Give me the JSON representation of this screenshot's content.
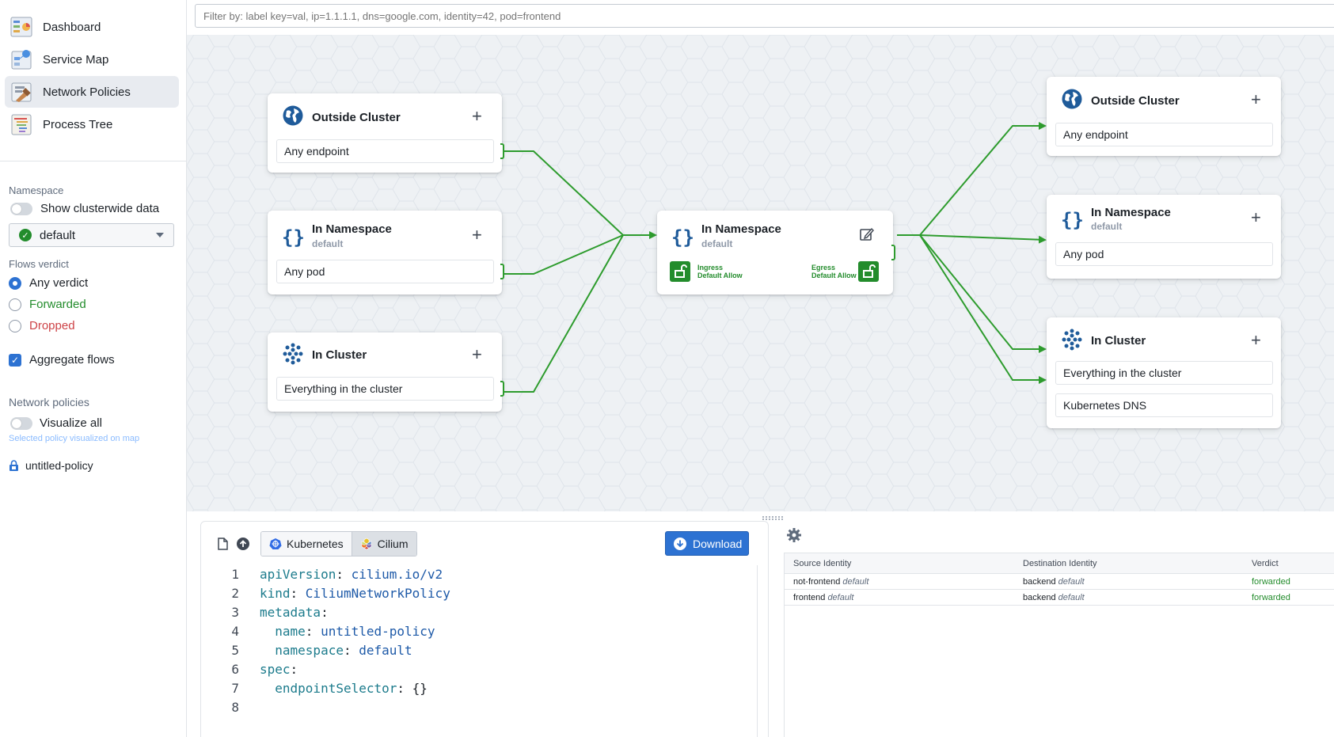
{
  "sidebar": {
    "nav": [
      {
        "label": "Dashboard",
        "icon": "dashboard-icon"
      },
      {
        "label": "Service Map",
        "icon": "service-map-icon"
      },
      {
        "label": "Network Policies",
        "icon": "network-policies-icon",
        "active": true
      },
      {
        "label": "Process Tree",
        "icon": "process-tree-icon"
      }
    ],
    "namespace_label": "Namespace",
    "show_clusterwide_label": "Show clusterwide data",
    "namespace_value": "default",
    "flows_verdict_label": "Flows verdict",
    "verdicts": [
      {
        "label": "Any verdict",
        "selected": true,
        "color": "#1c2127"
      },
      {
        "label": "Forwarded",
        "selected": false,
        "color": "#238c2c"
      },
      {
        "label": "Dropped",
        "selected": false,
        "color": "#cd4246"
      }
    ],
    "aggregate_flows_label": "Aggregate flows",
    "aggregate_flows_checked": true,
    "network_policies_label": "Network policies",
    "visualize_all_label": "Visualize all",
    "visualize_hint": "Selected policy visualized on map",
    "policy_name": "untitled-policy"
  },
  "filter": {
    "placeholder": "Filter by: label key=val, ip=1.1.1.1, dns=google.com, identity=42, pod=frontend"
  },
  "map": {
    "ingress_cards": [
      {
        "title": "Outside Cluster",
        "subtitle": "",
        "icon": "globe-icon",
        "rules": [
          "Any endpoint"
        ]
      },
      {
        "title": "In Namespace",
        "subtitle": "default",
        "icon": "braces-icon",
        "rules": [
          "Any pod"
        ]
      },
      {
        "title": "In Cluster",
        "subtitle": "",
        "icon": "cluster-icon",
        "rules": [
          "Everything in the cluster"
        ]
      }
    ],
    "center_card": {
      "title": "In Namespace",
      "subtitle": "default",
      "ingress_label_1": "Ingress",
      "ingress_label_2": "Default Allow",
      "egress_label_1": "Egress",
      "egress_label_2": "Default Allow"
    },
    "egress_cards": [
      {
        "title": "Outside Cluster",
        "subtitle": "",
        "icon": "globe-icon",
        "rules": [
          "Any endpoint"
        ]
      },
      {
        "title": "In Namespace",
        "subtitle": "default",
        "icon": "braces-icon",
        "rules": [
          "Any pod"
        ]
      },
      {
        "title": "In Cluster",
        "subtitle": "",
        "icon": "cluster-icon",
        "rules": [
          "Everything in the cluster",
          "Kubernetes DNS"
        ]
      }
    ],
    "line_color": "#2e9c2e"
  },
  "editor": {
    "tabs": [
      {
        "label": "Kubernetes",
        "active": false
      },
      {
        "label": "Cilium",
        "active": true
      }
    ],
    "download_label": "Download",
    "lines": [
      {
        "n": "1",
        "indent": "",
        "key": "apiVersion",
        "sep": ": ",
        "val": "cilium.io/v2"
      },
      {
        "n": "2",
        "indent": "",
        "key": "kind",
        "sep": ": ",
        "val": "CiliumNetworkPolicy"
      },
      {
        "n": "3",
        "indent": "",
        "key": "metadata",
        "sep": ":",
        "val": ""
      },
      {
        "n": "4",
        "indent": "  ",
        "key": "name",
        "sep": ": ",
        "val": "untitled-policy"
      },
      {
        "n": "5",
        "indent": "  ",
        "key": "namespace",
        "sep": ": ",
        "val": "default"
      },
      {
        "n": "6",
        "indent": "",
        "key": "spec",
        "sep": ":",
        "val": ""
      },
      {
        "n": "7",
        "indent": "  ",
        "key": "endpointSelector",
        "sep": ": ",
        "val": "{}"
      },
      {
        "n": "8",
        "indent": "",
        "key": "",
        "sep": "",
        "val": ""
      }
    ]
  },
  "flows": {
    "columns": [
      "Source Identity",
      "Destination Identity",
      "Verdict"
    ],
    "rows": [
      {
        "src": "not-frontend",
        "src_ns": "default",
        "dst": "backend",
        "dst_ns": "default",
        "verdict": "forwarded"
      },
      {
        "src": "frontend",
        "src_ns": "default",
        "dst": "backend",
        "dst_ns": "default",
        "verdict": "forwarded"
      }
    ]
  }
}
